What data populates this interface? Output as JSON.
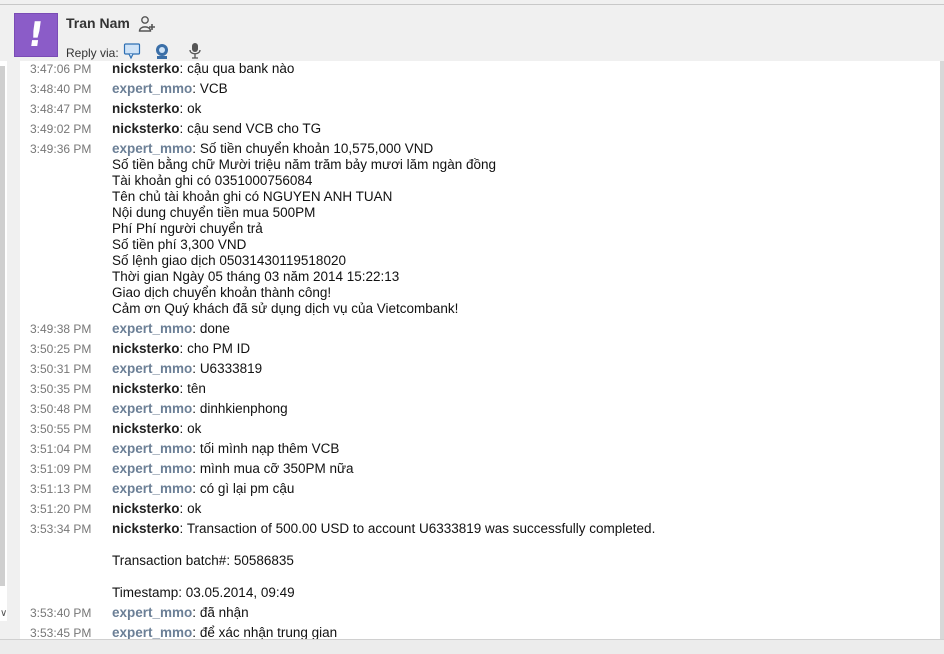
{
  "header": {
    "contact_name": "Tran Nam",
    "reply_label": "Reply via:",
    "icons": [
      "add-contact-icon",
      "chat-bubble-icon",
      "video-call-icon",
      "microphone-icon"
    ]
  },
  "messages": [
    {
      "time": "3:47:06 PM",
      "user": "nicksterko",
      "text": "cậu qua bank nào"
    },
    {
      "time": "3:48:40 PM",
      "user": "expert_mmo",
      "text": "VCB"
    },
    {
      "time": "3:48:47 PM",
      "user": "nicksterko",
      "text": "ok"
    },
    {
      "time": "3:49:02 PM",
      "user": "nicksterko",
      "text": "cậu send VCB cho TG"
    },
    {
      "time": "3:49:36 PM",
      "user": "expert_mmo",
      "text": "Số tiền chuyển khoản 10,575,000 VND\nSố tiền bằng chữ Mười triệu năm trăm bảy mươi lăm ngàn đồng\nTài khoản ghi có 0351000756084\nTên chủ tài khoản ghi có NGUYEN ANH TUAN\nNội dung chuyển tiền mua 500PM\nPhí Phí người chuyển trả\nSố tiền phí 3,300 VND\nSố lệnh giao dịch 05031430119518020\nThời gian Ngày 05 tháng 03 năm 2014 15:22:13\nGiao dịch chuyển khoản thành công!\nCảm ơn Quý khách đã sử dụng dịch vụ của Vietcombank!"
    },
    {
      "time": "3:49:38 PM",
      "user": "expert_mmo",
      "text": "done"
    },
    {
      "time": "3:50:25 PM",
      "user": "nicksterko",
      "text": "cho PM ID"
    },
    {
      "time": "3:50:31 PM",
      "user": "expert_mmo",
      "text": "U6333819"
    },
    {
      "time": "3:50:35 PM",
      "user": "nicksterko",
      "text": "tên"
    },
    {
      "time": "3:50:48 PM",
      "user": "expert_mmo",
      "text": "dinhkienphong"
    },
    {
      "time": "3:50:55 PM",
      "user": "nicksterko",
      "text": "ok"
    },
    {
      "time": "3:51:04 PM",
      "user": "expert_mmo",
      "text": "tối mình nạp thêm VCB"
    },
    {
      "time": "3:51:09 PM",
      "user": "expert_mmo",
      "text": "mình mua cỡ 350PM nữa"
    },
    {
      "time": "3:51:13 PM",
      "user": "expert_mmo",
      "text": "có gì lại pm cậu"
    },
    {
      "time": "3:51:20 PM",
      "user": "nicksterko",
      "text": "ok"
    },
    {
      "time": "3:53:34 PM",
      "user": "nicksterko",
      "text": "Transaction of 500.00 USD to account U6333819 was successfully completed.\n\nTransaction batch#: 50586835\n\nTimestamp: 03.05.2014, 09:49"
    },
    {
      "time": "3:53:40 PM",
      "user": "expert_mmo",
      "text": "đã nhận"
    },
    {
      "time": "3:53:45 PM",
      "user": "expert_mmo",
      "text": "để xác nhận trung gian"
    }
  ]
}
